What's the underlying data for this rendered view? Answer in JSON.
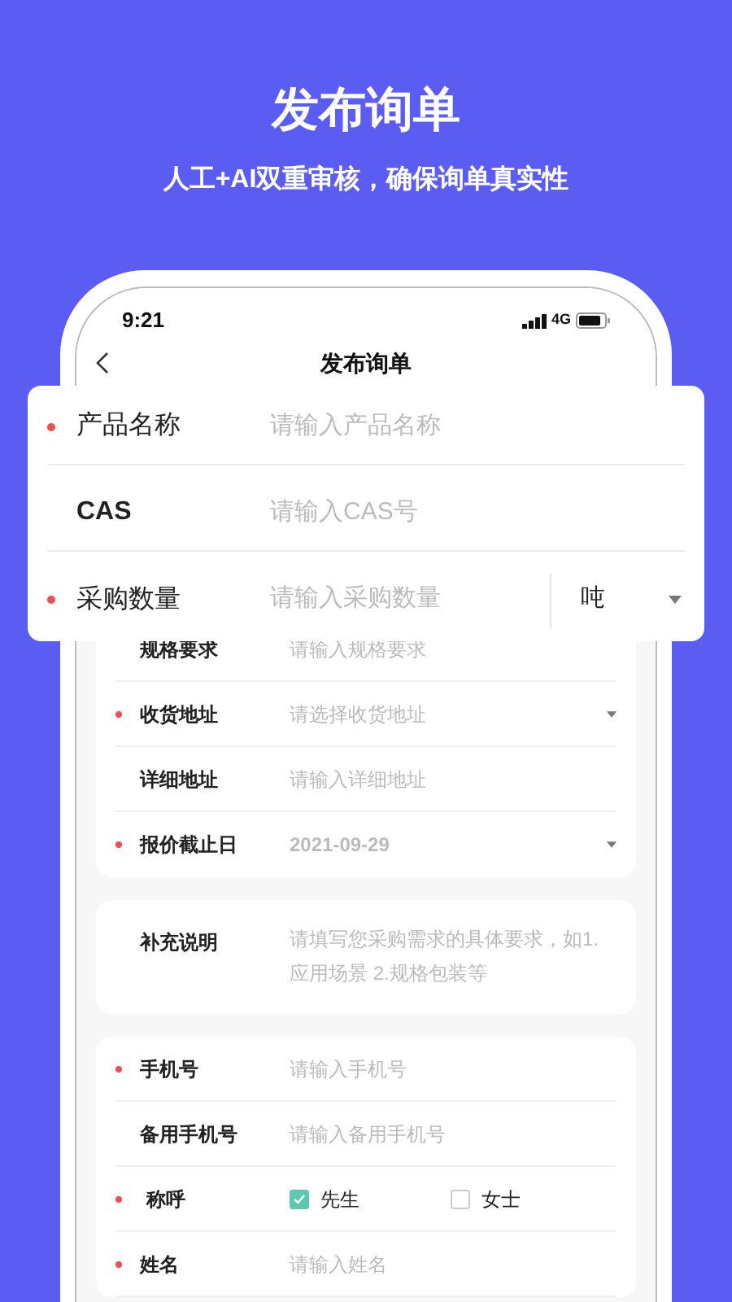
{
  "header": {
    "title": "发布询单",
    "subtitle": "人工+AI双重审核，确保询单真实性"
  },
  "status_bar": {
    "time": "9:21",
    "network": "4G"
  },
  "nav": {
    "title": "发布询单"
  },
  "featured_fields": [
    {
      "kind": "input",
      "label": "产品名称",
      "placeholder": "请输入产品名称",
      "required": true
    },
    {
      "kind": "input",
      "label": "CAS",
      "placeholder": "请输入CAS号",
      "required": false
    },
    {
      "kind": "unit",
      "label": "采购数量",
      "placeholder": "请输入采购数量",
      "required": true,
      "unit": "吨"
    }
  ],
  "sections": [
    {
      "fields": [
        {
          "kind": "input",
          "label": "规格要求",
          "placeholder": "请输入规格要求",
          "required": false
        },
        {
          "kind": "select",
          "label": "收货地址",
          "placeholder": "请选择收货地址",
          "required": true
        },
        {
          "kind": "input",
          "label": "详细地址",
          "placeholder": "请输入详细地址",
          "required": false
        },
        {
          "kind": "select",
          "label": "报价截止日",
          "value": "2021-09-29",
          "required": true
        }
      ]
    },
    {
      "fields": [
        {
          "kind": "textarea",
          "label": "补充说明",
          "placeholder": "请填写您采购需求的具体要求，如1.应用场景 2.规格包装等",
          "required": false
        }
      ]
    },
    {
      "fields": [
        {
          "kind": "input",
          "label": "手机号",
          "placeholder": "请输入手机号",
          "required": true
        },
        {
          "kind": "input",
          "label": "备用手机号",
          "placeholder": "请输入备用手机号",
          "required": false
        },
        {
          "kind": "radio",
          "label": "称呼",
          "required": true,
          "options": [
            {
              "label": "先生",
              "selected": true
            },
            {
              "label": "女士",
              "selected": false
            }
          ]
        },
        {
          "kind": "input",
          "label": "姓名",
          "placeholder": "请输入姓名",
          "required": true
        }
      ]
    }
  ]
}
